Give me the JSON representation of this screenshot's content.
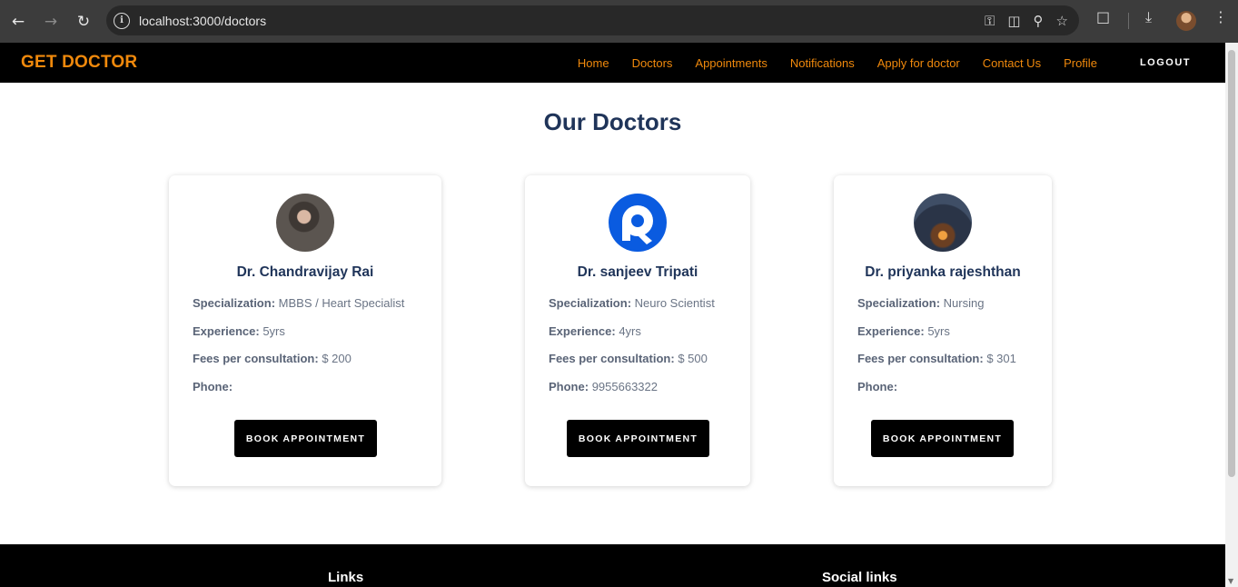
{
  "browser": {
    "url": "localhost:3000/doctors",
    "back_icon": "arrow-left-icon",
    "forward_icon": "arrow-right-icon",
    "reload_icon": "reload-icon"
  },
  "navbar": {
    "brand": "GET DOCTOR",
    "links": [
      "Home",
      "Doctors",
      "Appointments",
      "Notifications",
      "Apply for doctor",
      "Contact Us",
      "Profile"
    ],
    "logout": "LOGOUT"
  },
  "page": {
    "title": "Our Doctors"
  },
  "labels": {
    "specialization": "Specialization:",
    "experience": "Experience:",
    "fees": "Fees per consultation:",
    "phone": "Phone:"
  },
  "doctors": [
    {
      "name": "Dr. Chandravijay Rai",
      "specialization": "MBBS / Heart Specialist",
      "experience": "5yrs",
      "fees": "$ 200",
      "phone": "",
      "button": "BOOK APPOINTMENT"
    },
    {
      "name": "Dr. sanjeev Tripati",
      "specialization": "Neuro Scientist",
      "experience": "4yrs",
      "fees": "$ 500",
      "phone": "9955663322",
      "button": "BOOK APPOINTMENT"
    },
    {
      "name": "Dr. priyanka rajeshthan",
      "specialization": "Nursing",
      "experience": "5yrs",
      "fees": "$ 301",
      "phone": "",
      "button": "BOOK APPOINTMENT"
    }
  ],
  "footer": {
    "links_heading": "Links",
    "social_heading": "Social links"
  },
  "colors": {
    "brand": "#f0890c",
    "heading": "#1f3459",
    "navbar_bg": "#000000"
  }
}
